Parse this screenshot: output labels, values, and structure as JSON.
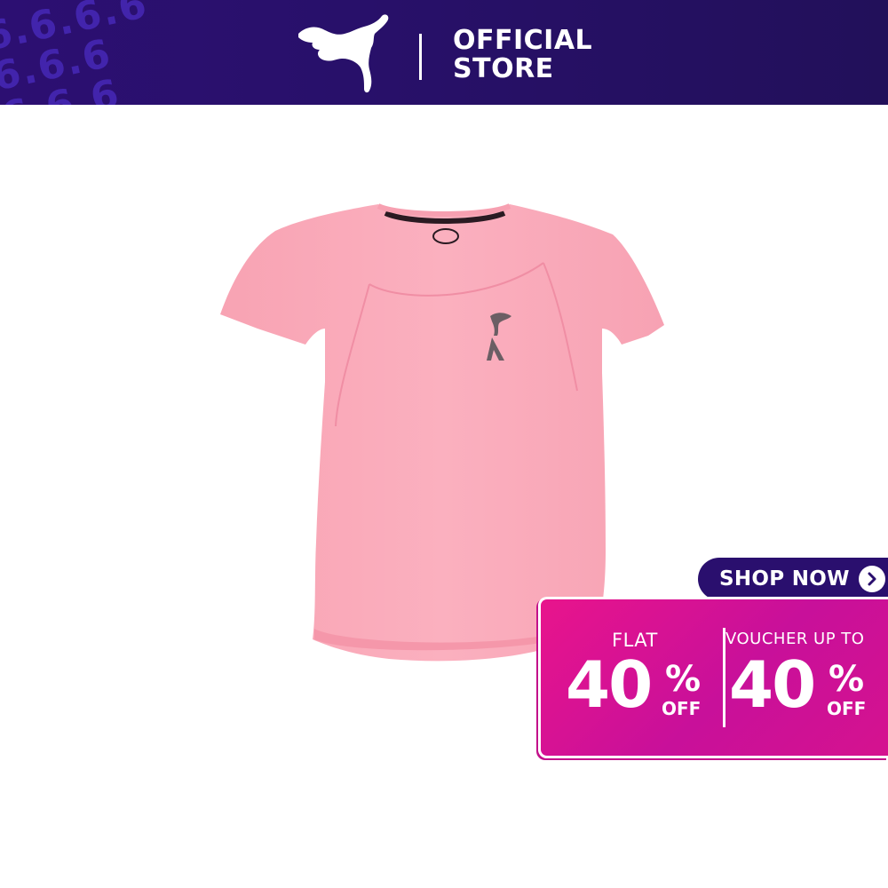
{
  "header": {
    "background_text": [
      "6.6.6.6",
      "6.6.6",
      "6.6.6"
    ],
    "store_line1": "OFFICIAL",
    "store_line2": "STORE",
    "logo_icon": "puma-cat-logo-icon",
    "color": "#2a0f6e"
  },
  "product": {
    "image_icon": "pink-tshirt-product-image",
    "color": "#f9a9b8"
  },
  "promo": {
    "shop_now_label": "SHOP NOW",
    "shop_now_icon": "chevron-right-icon",
    "flat_label": "FLAT",
    "flat_value": "40",
    "flat_percent": "%",
    "flat_off": "OFF",
    "voucher_label": "VOUCHER UP TO",
    "voucher_value": "40",
    "voucher_percent": "%",
    "voucher_off": "OFF",
    "accent_color": "#e0148f"
  }
}
